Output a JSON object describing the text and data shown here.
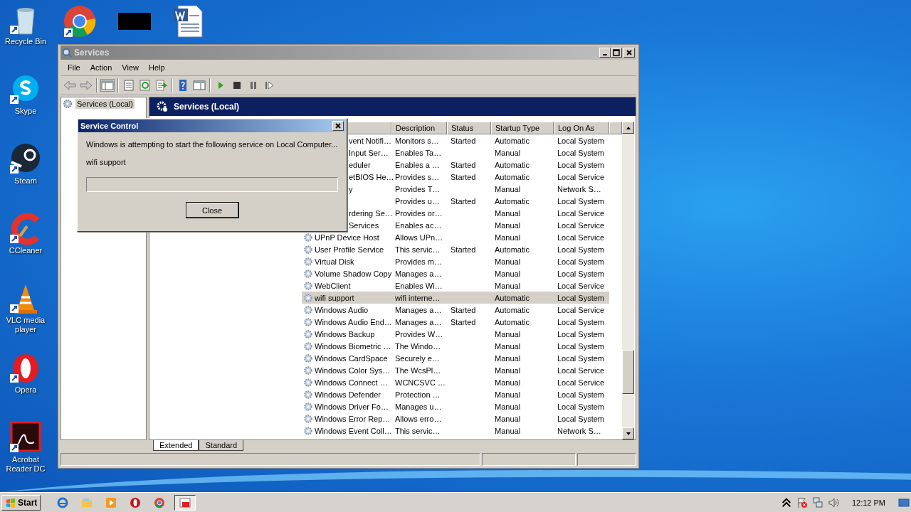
{
  "desktop": {
    "icons": [
      {
        "label": "Recycle Bin",
        "kind": "recycle"
      },
      {
        "label": "Skype",
        "kind": "skype"
      },
      {
        "label": "Steam",
        "kind": "steam"
      },
      {
        "label": "CCleaner",
        "kind": "ccleaner"
      },
      {
        "label": "VLC media player",
        "kind": "vlc"
      },
      {
        "label": "Opera",
        "kind": "opera"
      },
      {
        "label": "Acrobat Reader DC",
        "kind": "acrobat"
      }
    ],
    "top_icons": [
      {
        "kind": "chrome"
      },
      {
        "kind": "redacted"
      },
      {
        "kind": "word"
      }
    ]
  },
  "window": {
    "title": "Services",
    "menu": [
      "File",
      "Action",
      "View",
      "Help"
    ],
    "tree": [
      {
        "label": "Services (Local)",
        "selected": true
      }
    ],
    "pane_title": "Services (Local)",
    "columns": [
      "Description",
      "Status",
      "Startup Type",
      "Log On As"
    ],
    "rows": [
      {
        "name": "vent Notifi…",
        "partial": true,
        "description": "Monitors s…",
        "status": "Started",
        "startup": "Automatic",
        "logon": "Local System",
        "selected": false
      },
      {
        "name": "Input Ser…",
        "partial": true,
        "description": "Enables Ta…",
        "status": "",
        "startup": "Manual",
        "logon": "Local System",
        "selected": false
      },
      {
        "name": "eduler",
        "partial": true,
        "description": "Enables a …",
        "status": "Started",
        "startup": "Automatic",
        "logon": "Local System",
        "selected": false
      },
      {
        "name": "etBIOS He…",
        "partial": true,
        "description": "Provides s…",
        "status": "Started",
        "startup": "Automatic",
        "logon": "Local Service",
        "selected": false
      },
      {
        "name": "y",
        "partial": true,
        "description": "Provides T…",
        "status": "",
        "startup": "Manual",
        "logon": "Network S…",
        "selected": false
      },
      {
        "description": "Provides u…",
        "status": "Started",
        "startup": "Automatic",
        "logon": "Local System",
        "selected": false
      },
      {
        "name": "rdering Se…",
        "partial": true,
        "description": "Provides or…",
        "status": "",
        "startup": "Manual",
        "logon": "Local Service",
        "selected": false
      },
      {
        "name": "Services",
        "partial": true,
        "description": "Enables ac…",
        "status": "",
        "startup": "Manual",
        "logon": "Local Service",
        "selected": false
      },
      {
        "name": "UPnP Device Host",
        "partial": false,
        "description": "Allows UPn…",
        "status": "",
        "startup": "Manual",
        "logon": "Local Service",
        "selected": false
      },
      {
        "name": "User Profile Service",
        "partial": false,
        "description": "This servic…",
        "status": "Started",
        "startup": "Automatic",
        "logon": "Local System",
        "selected": false
      },
      {
        "name": "Virtual Disk",
        "partial": false,
        "description": "Provides m…",
        "status": "",
        "startup": "Manual",
        "logon": "Local System",
        "selected": false
      },
      {
        "name": "Volume Shadow Copy",
        "partial": false,
        "description": "Manages a…",
        "status": "",
        "startup": "Manual",
        "logon": "Local System",
        "selected": false
      },
      {
        "name": "WebClient",
        "partial": false,
        "description": "Enables Wi…",
        "status": "",
        "startup": "Manual",
        "logon": "Local Service",
        "selected": false
      },
      {
        "name": "wifi support",
        "partial": false,
        "description": "wifi interne…",
        "status": "",
        "startup": "Automatic",
        "logon": "Local System",
        "selected": true
      },
      {
        "name": "Windows Audio",
        "partial": false,
        "description": "Manages a…",
        "status": "Started",
        "startup": "Automatic",
        "logon": "Local Service",
        "selected": false
      },
      {
        "name": "Windows Audio End…",
        "partial": false,
        "description": "Manages a…",
        "status": "Started",
        "startup": "Automatic",
        "logon": "Local System",
        "selected": false
      },
      {
        "name": "Windows Backup",
        "partial": false,
        "description": "Provides W…",
        "status": "",
        "startup": "Manual",
        "logon": "Local System",
        "selected": false
      },
      {
        "name": "Windows Biometric …",
        "partial": false,
        "description": "The Windo…",
        "status": "",
        "startup": "Manual",
        "logon": "Local System",
        "selected": false
      },
      {
        "name": "Windows CardSpace",
        "partial": false,
        "description": "Securely e…",
        "status": "",
        "startup": "Manual",
        "logon": "Local System",
        "selected": false
      },
      {
        "name": "Windows Color Sys…",
        "partial": false,
        "description": "The WcsPl…",
        "status": "",
        "startup": "Manual",
        "logon": "Local Service",
        "selected": false
      },
      {
        "name": "Windows Connect …",
        "partial": false,
        "description": "WCNCSVC …",
        "status": "",
        "startup": "Manual",
        "logon": "Local Service",
        "selected": false
      },
      {
        "name": "Windows Defender",
        "partial": false,
        "description": "Protection …",
        "status": "",
        "startup": "Manual",
        "logon": "Local System",
        "selected": false
      },
      {
        "name": "Windows Driver Fo…",
        "partial": false,
        "description": "Manages u…",
        "status": "",
        "startup": "Manual",
        "logon": "Local System",
        "selected": false
      },
      {
        "name": "Windows Error Rep…",
        "partial": false,
        "description": "Allows erro…",
        "status": "",
        "startup": "Manual",
        "logon": "Local System",
        "selected": false
      },
      {
        "name": "Windows Event Coll…",
        "partial": false,
        "description": "This servic…",
        "status": "",
        "startup": "Manual",
        "logon": "Network S…",
        "selected": false
      }
    ],
    "tabs": [
      {
        "label": "Extended",
        "selected": true
      },
      {
        "label": "Standard",
        "selected": false
      }
    ]
  },
  "dialog": {
    "title": "Service Control",
    "message": "Windows is attempting to start the following service on Local Computer...",
    "service": "wifi support",
    "level": 0,
    "button": "Close"
  },
  "taskbar": {
    "start": "Start",
    "apps": [
      {
        "kind": "ie",
        "selected": false
      },
      {
        "kind": "explorer",
        "selected": false
      },
      {
        "kind": "media",
        "selected": false
      },
      {
        "kind": "opera",
        "selected": false
      },
      {
        "kind": "chrome",
        "selected": false
      },
      {
        "kind": "services",
        "selected": true
      }
    ],
    "clock": "12:12 PM"
  }
}
